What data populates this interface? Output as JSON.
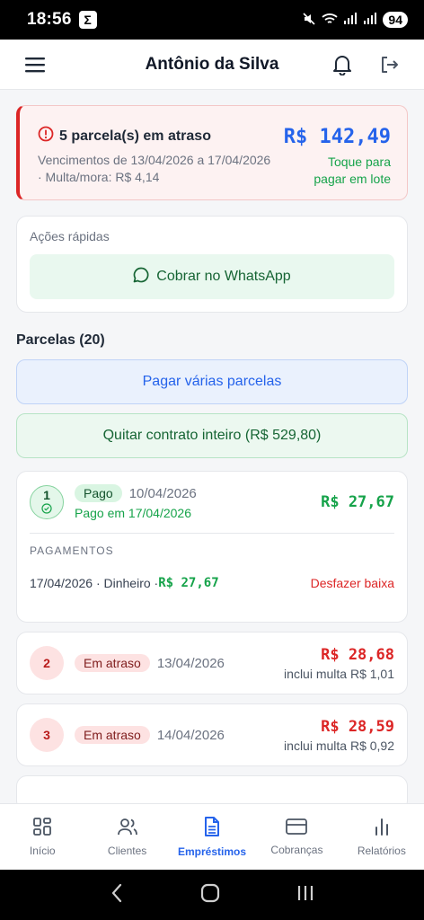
{
  "status_bar": {
    "time": "18:56",
    "app_glyph": "Σ",
    "battery": "94"
  },
  "header": {
    "title": "Antônio da Silva",
    "icons": [
      "menu-icon",
      "bell-icon",
      "logout-icon"
    ]
  },
  "overdue": {
    "title": "5 parcela(s) em atraso",
    "due_range": "Vencimentos de 13/04/2026 a 17/04/2026",
    "fine": "· Multa/mora: R$ 4,14",
    "amount": "R$ 142,49",
    "hint_line1": "Toque para",
    "hint_line2": "pagar em lote"
  },
  "quick_actions": {
    "label": "Ações rápidas",
    "whatsapp_button": "Cobrar no WhatsApp"
  },
  "installments_section": {
    "title": "Parcelas (20)",
    "pay_multiple": "Pagar várias parcelas",
    "settle_contract": "Quitar contrato inteiro (R$ 529,80)"
  },
  "installments": [
    {
      "number": "1",
      "status": "Pago",
      "due_date": "10/04/2026",
      "paid_on": "Pago em 17/04/2026",
      "amount": "R$ 27,67",
      "payments_header": "PAGAMENTOS",
      "payment": {
        "date_method": "17/04/2026 · Dinheiro · ",
        "amount": "R$ 27,67",
        "undo": "Desfazer baixa"
      }
    },
    {
      "number": "2",
      "status": "Em atraso",
      "due_date": "13/04/2026",
      "amount": "R$ 28,68",
      "fine": "inclui multa R$ 1,01"
    },
    {
      "number": "3",
      "status": "Em atraso",
      "due_date": "14/04/2026",
      "amount": "R$ 28,59",
      "fine": "inclui multa R$ 0,92"
    }
  ],
  "bottom_nav": [
    {
      "label": "Início",
      "icon": "grid-icon"
    },
    {
      "label": "Clientes",
      "icon": "users-icon"
    },
    {
      "label": "Empréstimos",
      "icon": "document-icon",
      "active": true
    },
    {
      "label": "Cobranças",
      "icon": "card-icon"
    },
    {
      "label": "Relatórios",
      "icon": "bar-chart-icon"
    }
  ],
  "colors": {
    "primary": "#2563eb",
    "success": "#16a34a",
    "danger": "#dc2626"
  }
}
